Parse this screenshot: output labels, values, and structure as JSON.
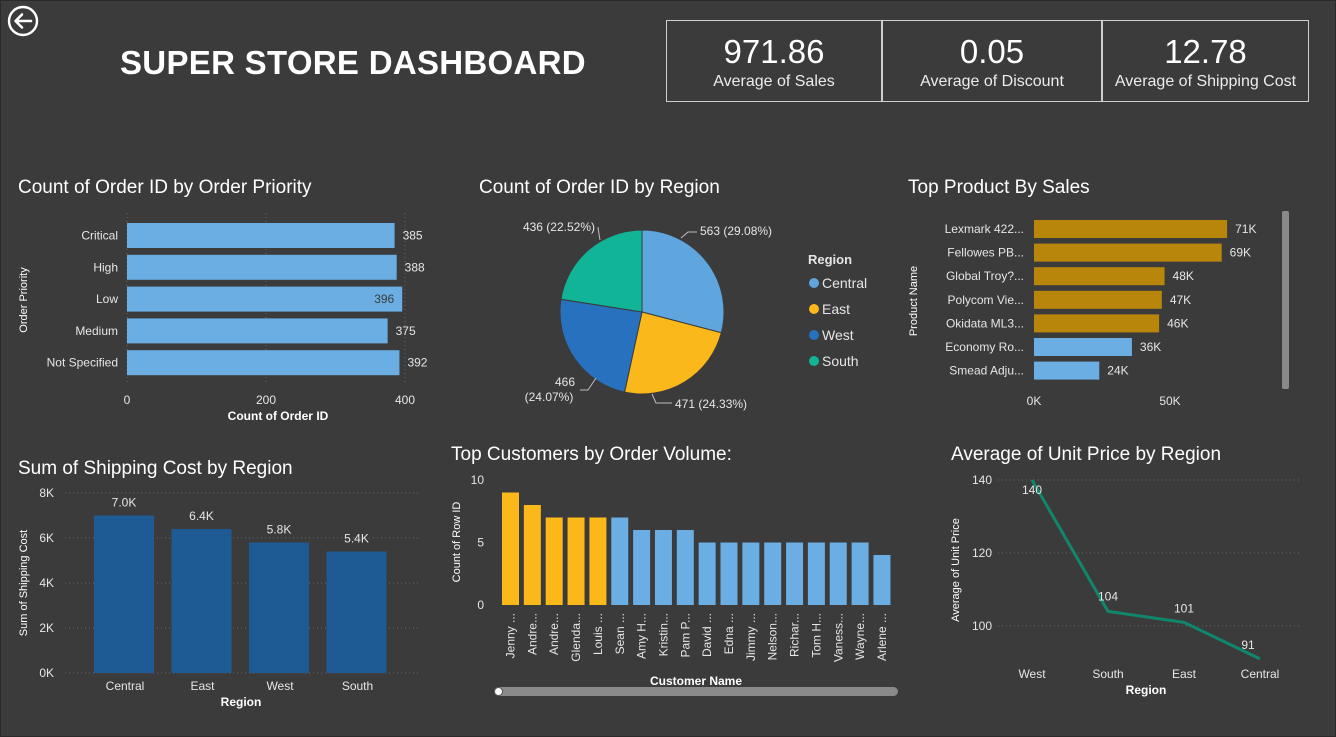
{
  "header": {
    "title": "SUPER STORE DASHBOARD",
    "back_icon": "back-arrow-icon"
  },
  "kpis": [
    {
      "value": "971.86",
      "label": "Average of Sales"
    },
    {
      "value": "0.05",
      "label": "Average of Discount"
    },
    {
      "value": "12.78",
      "label": "Average of Shipping Cost"
    }
  ],
  "colors": {
    "background": "#3b3b3b",
    "light_blue": "#6aaee3",
    "gold": "#b8860b",
    "orange": "#fbb81a",
    "dark_blue": "#1e5b94",
    "teal": "#10866c",
    "pie_central": "#5ea6dd",
    "pie_east": "#fbb81a",
    "pie_west": "#2771be",
    "pie_south": "#11b496"
  },
  "chart_data": [
    {
      "id": "priority",
      "type": "bar",
      "orientation": "horizontal",
      "title": "Count of Order ID by Order Priority",
      "xlabel": "Count of Order ID",
      "ylabel": "Order Priority",
      "categories": [
        "Critical",
        "High",
        "Low",
        "Medium",
        "Not Specified"
      ],
      "values": [
        385,
        388,
        396,
        375,
        392
      ],
      "data_labels": [
        "385",
        "388",
        "396",
        "375",
        "392"
      ],
      "xlim": [
        0,
        400
      ],
      "xticks": [
        "0",
        "200",
        "400"
      ],
      "grid": true
    },
    {
      "id": "region_pie",
      "type": "pie",
      "title": "Count of Order ID by Region",
      "legend_title": "Region",
      "legend_position": "right",
      "categories": [
        "Central",
        "East",
        "West",
        "South"
      ],
      "values": [
        563,
        471,
        466,
        436
      ],
      "data_labels": [
        "563 (29.08%)",
        "471 (24.33%)",
        "466",
        "(24.07%)",
        "436 (22.52%)"
      ]
    },
    {
      "id": "top_products",
      "type": "bar",
      "orientation": "horizontal",
      "title": "Top Product By Sales",
      "ylabel": "Product Name",
      "categories": [
        "Lexmark 422...",
        "Fellowes PB...",
        "Global Troy?...",
        "Polycom Vie...",
        "Okidata ML3...",
        "Economy Ro...",
        "Smead Adju..."
      ],
      "values": [
        71000,
        69000,
        48000,
        47000,
        46000,
        36000,
        24000
      ],
      "data_labels": [
        "71K",
        "69K",
        "48K",
        "47K",
        "46K",
        "36K",
        "24K"
      ],
      "highlight": [
        true,
        true,
        true,
        true,
        true,
        false,
        false
      ],
      "xlim": [
        0,
        70000
      ],
      "xticks": [
        "0K",
        "50K"
      ]
    },
    {
      "id": "shipping_cost",
      "type": "bar",
      "title": "Sum of Shipping Cost by Region",
      "xlabel": "Region",
      "ylabel": "Sum of Shipping Cost",
      "categories": [
        "Central",
        "East",
        "West",
        "South"
      ],
      "values": [
        7000,
        6400,
        5800,
        5400
      ],
      "data_labels": [
        "7.0K",
        "6.4K",
        "5.8K",
        "5.4K"
      ],
      "ylim": [
        0,
        8000
      ],
      "yticks": [
        "0K",
        "2K",
        "4K",
        "6K",
        "8K"
      ],
      "grid": true
    },
    {
      "id": "top_customers",
      "type": "bar",
      "title": "Top Customers by Order Volume:",
      "xlabel": "Customer Name",
      "ylabel": "Count of Row ID",
      "categories": [
        "Jenny ...",
        "Andre...",
        "Andre...",
        "Glenda...",
        "Louis ...",
        "Sean ...",
        "Amy H...",
        "Kristin...",
        "Pam P...",
        "David ...",
        "Edna ...",
        "Jimmy ...",
        "Nelson...",
        "Richar...",
        "Tom H...",
        "Vaness...",
        "Wayne...",
        "Arlene ..."
      ],
      "values": [
        9,
        8,
        7,
        7,
        7,
        7,
        6,
        6,
        6,
        5,
        5,
        5,
        5,
        5,
        5,
        5,
        5,
        4
      ],
      "highlight": [
        true,
        true,
        true,
        true,
        true,
        false,
        false,
        false,
        false,
        false,
        false,
        false,
        false,
        false,
        false,
        false,
        false,
        false
      ],
      "ylim": [
        0,
        10
      ],
      "yticks": [
        "0",
        "5",
        "10"
      ]
    },
    {
      "id": "unit_price",
      "type": "line",
      "title": "Average of Unit Price by Region",
      "xlabel": "Region",
      "ylabel": "Average of Unit Price",
      "categories": [
        "West",
        "South",
        "East",
        "Central"
      ],
      "values": [
        140,
        104,
        101,
        91
      ],
      "data_labels": [
        "140",
        "104",
        "101",
        "91"
      ],
      "ylim": [
        90,
        140
      ],
      "yticks": [
        "100",
        "120",
        "140"
      ],
      "grid": true
    }
  ]
}
